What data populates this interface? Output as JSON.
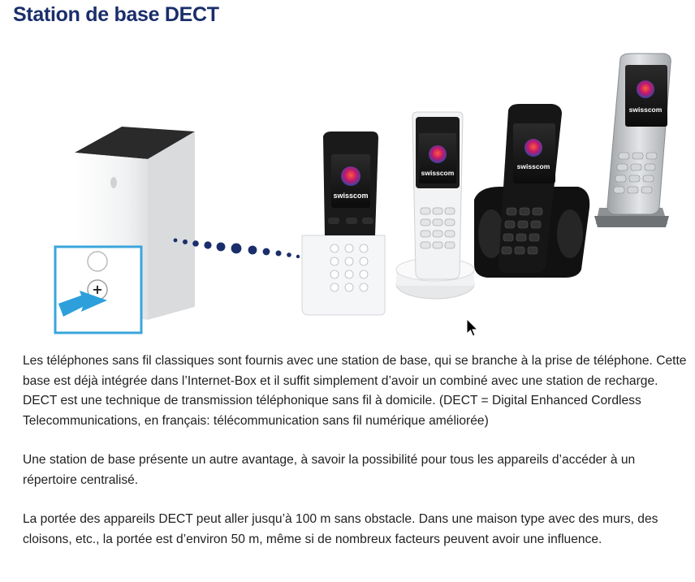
{
  "page": {
    "title": "Station de base DECT"
  },
  "illustration": {
    "brand_label": "swisscom",
    "plus_symbol": "+",
    "accent_color": "#3aa6dc",
    "signal_color": "#1a2e6b"
  },
  "paragraphs": [
    "Les téléphones sans fil classiques sont fournis avec une station de base, qui se branche à la prise de téléphone. Cette base est déjà intégrée dans l’Internet-Box et il suffit simplement d’avoir un combiné avec une station de recharge. DECT est une technique de transmission téléphonique sans fil à domicile. (DECT = Digital Enhanced Cordless Telecommunications, en français: télécommunication sans fil numérique améliorée)",
    "Une station de base présente un autre avantage, à savoir la possibilité pour tous les appareils d’accéder à un répertoire centralisé.",
    "La portée des appareils DECT peut aller jusqu’à 100 m sans obstacle. Dans une maison type avec des murs, des cloisons, etc., la portée est d’environ 50 m, même si de nombreux facteurs peuvent avoir une influence."
  ]
}
